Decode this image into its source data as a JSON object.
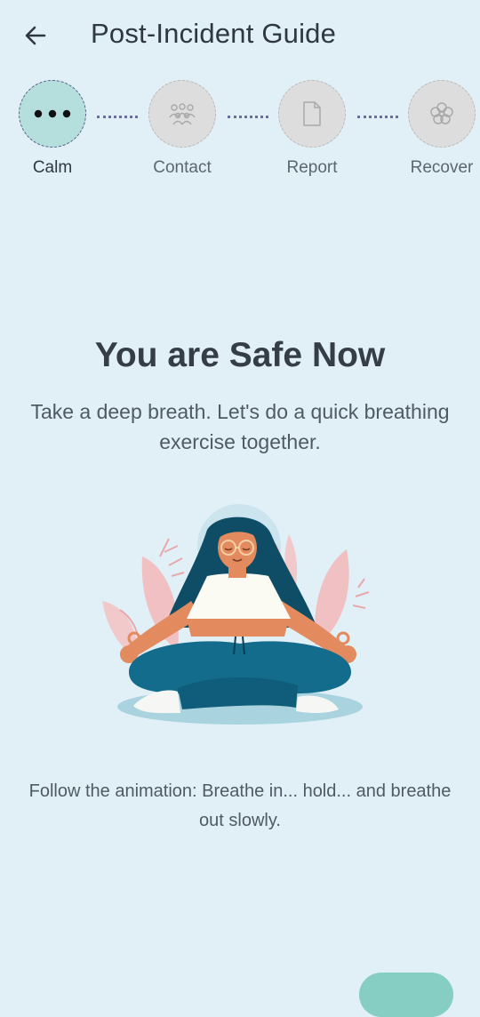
{
  "header": {
    "title": "Post-Incident Guide",
    "back_icon": "arrow-left-icon"
  },
  "stepper": {
    "steps": [
      {
        "label": "Calm",
        "icon": "dots-icon",
        "active": true
      },
      {
        "label": "Contact",
        "icon": "people-icon",
        "active": false
      },
      {
        "label": "Report",
        "icon": "document-icon",
        "active": false
      },
      {
        "label": "Recover",
        "icon": "flower-icon",
        "active": false
      }
    ]
  },
  "main": {
    "title": "You are Safe Now",
    "subtitle": "Take a deep breath. Let's do a quick breathing exercise together.",
    "illustration": "meditating-woman-illustration",
    "instruction": "Follow the animation: Breathe in... hold... and breathe out slowly."
  },
  "colors": {
    "background": "#e1f0f7",
    "active_step": "#b5dfdc",
    "inactive_step": "#dddddd",
    "accent": "#86cdc4",
    "connector": "#6a6f9e"
  }
}
